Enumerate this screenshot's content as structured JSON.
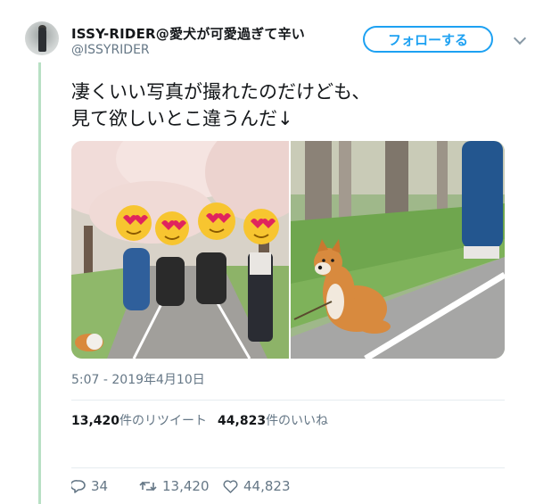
{
  "author": {
    "display_name": "ISSY-RIDER@愛犬が可愛過ぎて辛い",
    "handle": "@ISSYRIDER"
  },
  "follow_button_label": "フォローする",
  "tweet": {
    "text_line1": "凄くいい写真が撮れたのだけども、",
    "text_line2": "見て欲しいとこ違うんだ↓",
    "timestamp": "5:07 - 2019年4月10日"
  },
  "stats": {
    "retweet_count": "13,420",
    "retweet_label": "件のリツイート",
    "like_count": "44,823",
    "like_label": "件のいいね"
  },
  "actions": {
    "reply_count": "34",
    "retweet_count": "13,420",
    "like_count": "44,823"
  },
  "icons": {
    "menu": "chevron-down-icon",
    "reply": "reply-icon",
    "retweet": "retweet-icon",
    "like": "heart-icon"
  },
  "colors": {
    "accent": "#1da1f2",
    "thread_line": "#b8e0c4",
    "muted_text": "#657786"
  }
}
